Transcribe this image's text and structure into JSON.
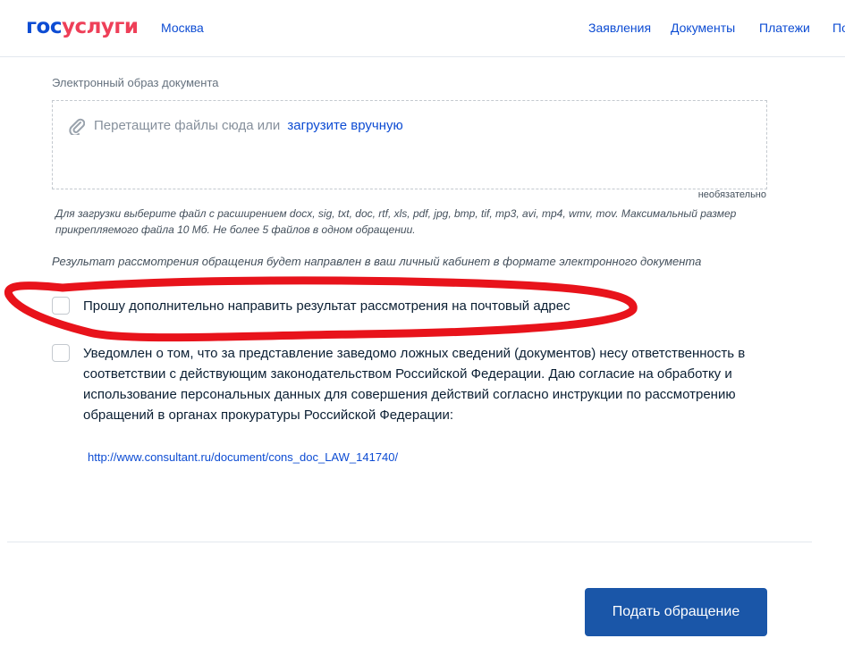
{
  "header": {
    "logo_part1": "гос",
    "logo_part2": "услуги",
    "city": "Москва",
    "nav": [
      "Заявления",
      "Документы",
      "Платежи",
      "По"
    ]
  },
  "upload": {
    "label": "Электронный образ документа",
    "drop_text": "Перетащите файлы сюда или",
    "drop_link": "загрузите вручную",
    "optional": "необязательно",
    "hint": "Для загрузки выберите файл с расширением docx, sig, txt, doc, rtf, xls, pdf, jpg, bmp, tif, mp3, avi, mp4, wmv, mov. Максимальный размер прикрепляемого файла 10 Мб. Не более 5 файлов в одном обращении."
  },
  "result_note": "Результат рассмотрения обращения будет направлен в ваш личный кабинет в формате электронного документа",
  "checkboxes": [
    {
      "label": "Прошу дополнительно направить результат рассмотрения на почтовый адрес",
      "checked": false
    },
    {
      "label": "Уведомлен о том, что за представление заведомо ложных сведений (документов) несу ответственность в соответствии с действующим законодательством Российской Федерации. Даю согласие на обработку и использование персональных данных для совершения действий согласно инструкции по рассмотрению обращений в органах прокуратуры Российской Федерации:",
      "checked": false
    }
  ],
  "law_link": "http://www.consultant.ru/document/cons_doc_LAW_141740/",
  "submit_label": "Подать обращение",
  "colors": {
    "accent": "#0d4cd3",
    "button": "#1a56a8",
    "annotation": "#e8131b"
  }
}
